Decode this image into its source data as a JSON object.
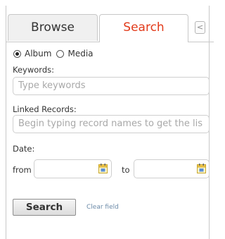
{
  "tabs": [
    {
      "label": "Browse",
      "active": false
    },
    {
      "label": "Search",
      "active": true
    }
  ],
  "collapse_glyph": "<",
  "scope": {
    "options": [
      {
        "label": "Album",
        "selected": true
      },
      {
        "label": "Media",
        "selected": false
      }
    ]
  },
  "keywords": {
    "label": "Keywords:",
    "placeholder": "Type keywords"
  },
  "linked_records": {
    "label": "Linked Records:",
    "placeholder": "Begin typing record names to get the lis"
  },
  "date": {
    "label": "Date:",
    "from_label": "from",
    "to_label": "to",
    "from_value": "",
    "to_value": ""
  },
  "actions": {
    "search_label": "Search",
    "clear_label": "Clear field"
  },
  "colors": {
    "active_tab": "#e23a1a",
    "link": "#6b8aa8",
    "border": "#c8c8c8"
  },
  "icons": [
    "calendar-icon",
    "collapse-icon"
  ]
}
